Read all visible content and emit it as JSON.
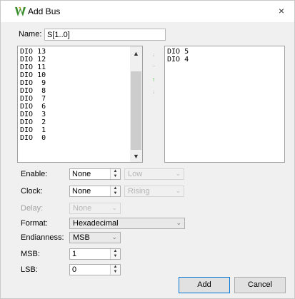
{
  "window": {
    "title": "Add Bus",
    "close_glyph": "×",
    "icon": "app-logo-icon"
  },
  "name": {
    "label": "Name:",
    "value": "S[1..0]"
  },
  "available_list": {
    "items": [
      "DIO 13",
      "DIO 12",
      "DIO 11",
      "DIO 10",
      "DIO  9",
      "DIO  8",
      "DIO  7",
      "DIO  6",
      "DIO  3",
      "DIO  2",
      "DIO  1",
      "DIO  0"
    ]
  },
  "selected_list": {
    "items": [
      "DIO 5",
      "DIO 4"
    ]
  },
  "move_buttons": {
    "top": "↓",
    "up": "−",
    "add": "↑",
    "bottom": "↓"
  },
  "fields": {
    "enable": {
      "label": "Enable:",
      "value": "None",
      "option": "Low"
    },
    "clock": {
      "label": "Clock:",
      "value": "None",
      "option": "Rising"
    },
    "delay": {
      "label": "Delay:",
      "value": "None"
    },
    "format": {
      "label": "Format:",
      "value": "Hexadecimal"
    },
    "endianness": {
      "label": "Endianness:",
      "value": "MSB"
    },
    "msb": {
      "label": "MSB:",
      "value": "1"
    },
    "lsb": {
      "label": "LSB:",
      "value": "0"
    }
  },
  "buttons": {
    "add": "Add",
    "cancel": "Cancel"
  },
  "colors": {
    "accent": "#0078d7",
    "logo": "#3a8f2e"
  }
}
